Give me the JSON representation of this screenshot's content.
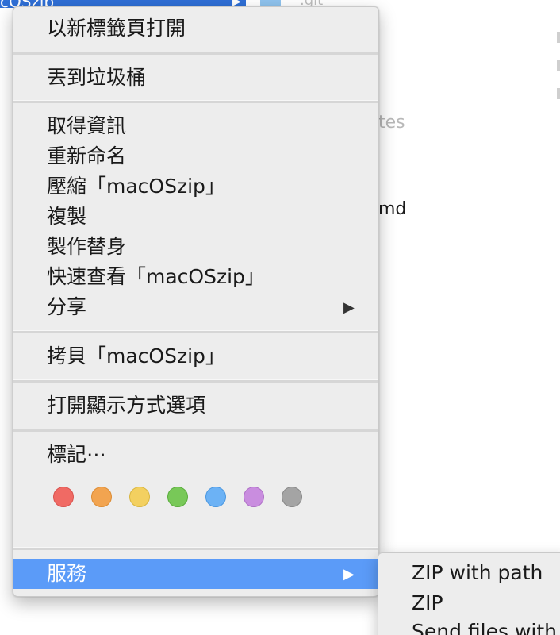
{
  "background": {
    "selected_item_fragment": "cOSzip",
    "selected_arrow": "▶",
    "git_fragment": ".git",
    "fragments": [
      {
        "id": "tes",
        "text": "tes",
        "color": "#b8b8b8"
      },
      {
        "id": "md",
        "text": "md",
        "color": "#1a1a1a"
      }
    ]
  },
  "menu": {
    "sections": [
      [
        {
          "id": "open-in-new-tab",
          "label": "以新標籤頁打開"
        }
      ],
      [
        {
          "id": "move-to-trash",
          "label": "丟到垃圾桶"
        }
      ],
      [
        {
          "id": "get-info",
          "label": "取得資訊"
        },
        {
          "id": "rename",
          "label": "重新命名"
        },
        {
          "id": "compress",
          "label": "壓縮「macOSzip」"
        },
        {
          "id": "duplicate",
          "label": "複製"
        },
        {
          "id": "make-alias",
          "label": "製作替身"
        },
        {
          "id": "quick-look",
          "label": "快速查看「macOSzip」"
        },
        {
          "id": "share",
          "label": "分享",
          "submenu": true
        }
      ],
      [
        {
          "id": "copy",
          "label": "拷貝「macOSzip」"
        }
      ],
      [
        {
          "id": "show-view-options",
          "label": "打開顯示方式選項"
        }
      ],
      [
        {
          "id": "tags",
          "label": "標記⋯"
        }
      ],
      [
        {
          "id": "services",
          "label": "服務",
          "submenu": true,
          "highlighted": true
        }
      ]
    ],
    "submenu_arrow": "▶",
    "tag_colors": [
      {
        "name": "red",
        "fill": "#f06a64",
        "stroke": "#d9534f"
      },
      {
        "name": "orange",
        "fill": "#f2a450",
        "stroke": "#dc8c35"
      },
      {
        "name": "yellow",
        "fill": "#f3d060",
        "stroke": "#d9b640"
      },
      {
        "name": "green",
        "fill": "#78c858",
        "stroke": "#5aad3d"
      },
      {
        "name": "blue",
        "fill": "#6cb2f5",
        "stroke": "#4a97e0"
      },
      {
        "name": "purple",
        "fill": "#c98ddf",
        "stroke": "#ae70c6"
      },
      {
        "name": "gray",
        "fill": "#a4a4a4",
        "stroke": "#888888"
      }
    ]
  },
  "services_submenu": {
    "items": [
      {
        "id": "zip-with-path",
        "label": "ZIP with path"
      },
      {
        "id": "zip",
        "label": "ZIP"
      },
      {
        "id": "send-files-with",
        "label": "Send files with"
      }
    ]
  },
  "colors": {
    "highlight": "#5b9bf8",
    "selection": "#2f6fd6",
    "menu_background": "#ededed"
  }
}
